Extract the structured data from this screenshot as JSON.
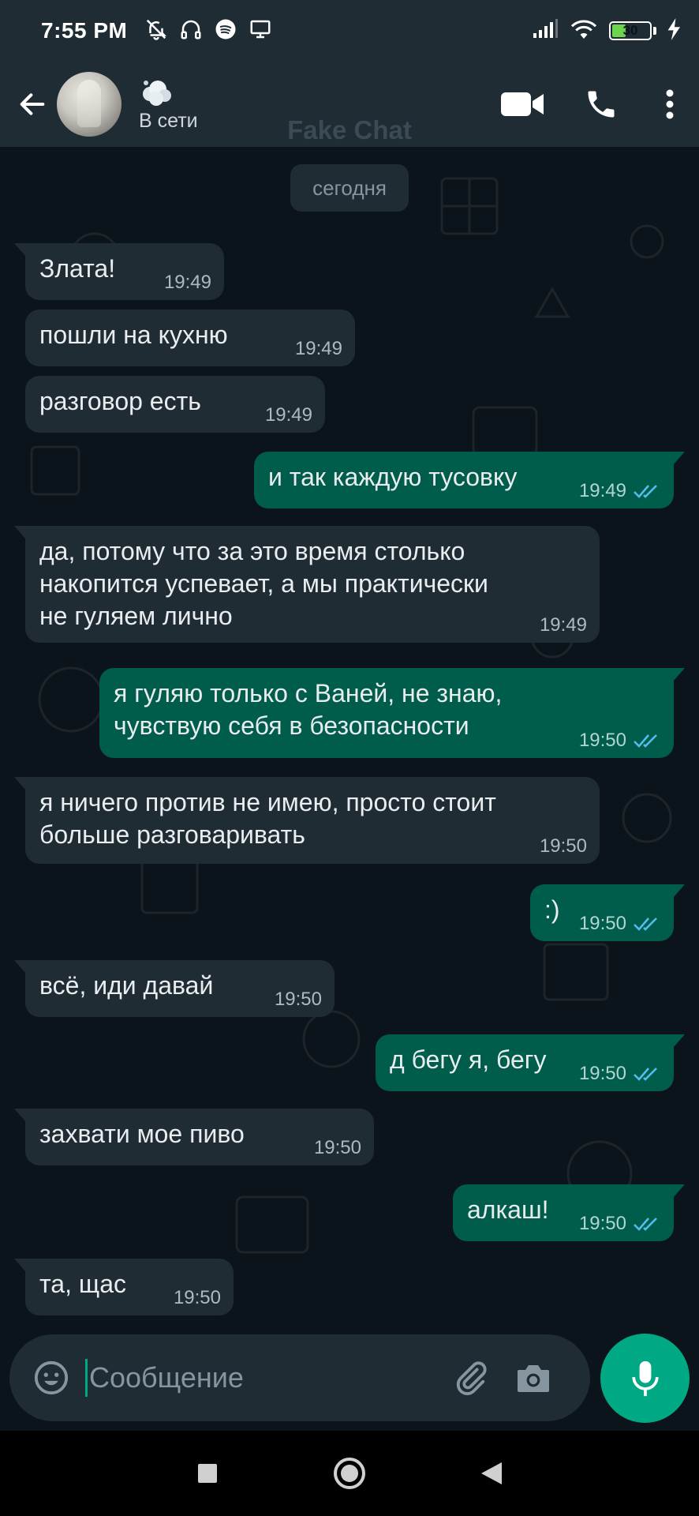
{
  "status_bar": {
    "time": "7:55 PM",
    "battery_level": "30",
    "battery_color": "#6ed44b"
  },
  "header": {
    "contact_status": "В сети",
    "icons": [
      "back-arrow-icon",
      "video-call-icon",
      "voice-call-icon",
      "more-vert-icon"
    ]
  },
  "chat": {
    "watermark": "Fake Chat",
    "date_chip": "сегодня",
    "messages": [
      {
        "dir": "in",
        "text": "Злата!",
        "time": "19:49"
      },
      {
        "dir": "in",
        "text": "пошли на кухню",
        "time": "19:49"
      },
      {
        "dir": "in",
        "text": "разговор есть",
        "time": "19:49"
      },
      {
        "dir": "out",
        "text": "и так каждую тусовку",
        "time": "19:49",
        "read": true
      },
      {
        "dir": "in",
        "text": "да, потому что за это время столько\nнакопится успевает, а мы практически\nне гуляем лично",
        "time": "19:49"
      },
      {
        "dir": "out",
        "text": "я гуляю только с Ваней, не знаю,\nчувствую себя в безопасности",
        "time": "19:50",
        "read": true
      },
      {
        "dir": "in",
        "text": "я ничего против не имею, просто стоит\nбольше разговаривать",
        "time": "19:50"
      },
      {
        "dir": "out",
        "text": ":)",
        "time": "19:50",
        "read": true
      },
      {
        "dir": "in",
        "text": "всё, иди давай",
        "time": "19:50"
      },
      {
        "dir": "out",
        "text": "д бегу я, бегу",
        "time": "19:50",
        "read": true
      },
      {
        "dir": "in",
        "text": "захвати мое пиво",
        "time": "19:50"
      },
      {
        "dir": "out",
        "text": "алкаш!",
        "time": "19:50",
        "read": true
      },
      {
        "dir": "in",
        "text": "та, щас",
        "time": "19:50"
      }
    ]
  },
  "input": {
    "placeholder": "Сообщение"
  },
  "colors": {
    "background": "#0b141a",
    "header": "#1f2c34",
    "incoming_bubble": "#202c33",
    "outgoing_bubble": "#005c4b",
    "accent": "#00a884",
    "read_ticks": "#53bdeb"
  }
}
